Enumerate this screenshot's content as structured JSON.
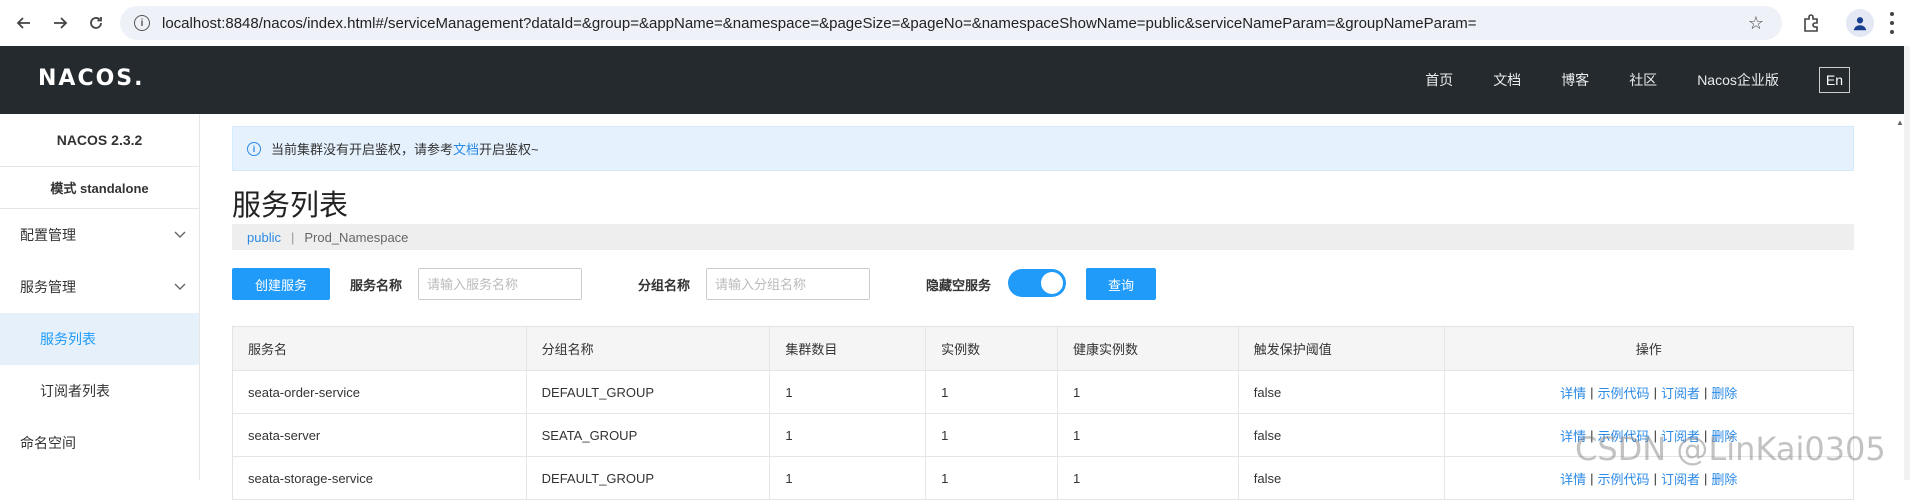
{
  "browser": {
    "url": "localhost:8848/nacos/index.html#/serviceManagement?dataId=&group=&appName=&namespace=&pageSize=&pageNo=&namespaceShowName=public&serviceNameParam=&groupNameParam="
  },
  "header": {
    "logo": "NACOS.",
    "nav": [
      "首页",
      "文档",
      "博客",
      "社区",
      "Nacos企业版"
    ],
    "lang": "En"
  },
  "sidebar": {
    "version": "NACOS 2.3.2",
    "mode": "模式 standalone",
    "items": [
      {
        "label": "配置管理"
      },
      {
        "label": "服务管理"
      },
      {
        "label": "服务列表"
      },
      {
        "label": "订阅者列表"
      },
      {
        "label": "命名空间"
      }
    ]
  },
  "notice": {
    "prefix": "当前集群没有开启鉴权，请参考",
    "link": "文档",
    "suffix": "开启鉴权~"
  },
  "page_title": "服务列表",
  "namespace": {
    "current": "public",
    "separator": "|",
    "other": "Prod_Namespace"
  },
  "filter": {
    "create_label": "创建服务",
    "service_name_label": "服务名称",
    "service_name_placeholder": "请输入服务名称",
    "group_name_label": "分组名称",
    "group_name_placeholder": "请输入分组名称",
    "hide_empty_label": "隐藏空服务",
    "hide_empty_on": true,
    "query_label": "查询"
  },
  "table": {
    "headers": [
      "服务名",
      "分组名称",
      "集群数目",
      "实例数",
      "健康实例数",
      "触发保护阈值",
      "操作"
    ],
    "rows": [
      [
        "seata-order-service",
        "DEFAULT_GROUP",
        "1",
        "1",
        "1",
        "false"
      ],
      [
        "seata-server",
        "SEATA_GROUP",
        "1",
        "1",
        "1",
        "false"
      ],
      [
        "seata-storage-service",
        "DEFAULT_GROUP",
        "1",
        "1",
        "1",
        "false"
      ]
    ],
    "ops": [
      "详情",
      "示例代码",
      "订阅者",
      "删除"
    ],
    "op_sep": "|"
  },
  "watermark": "CSDN @LinKai0305"
}
